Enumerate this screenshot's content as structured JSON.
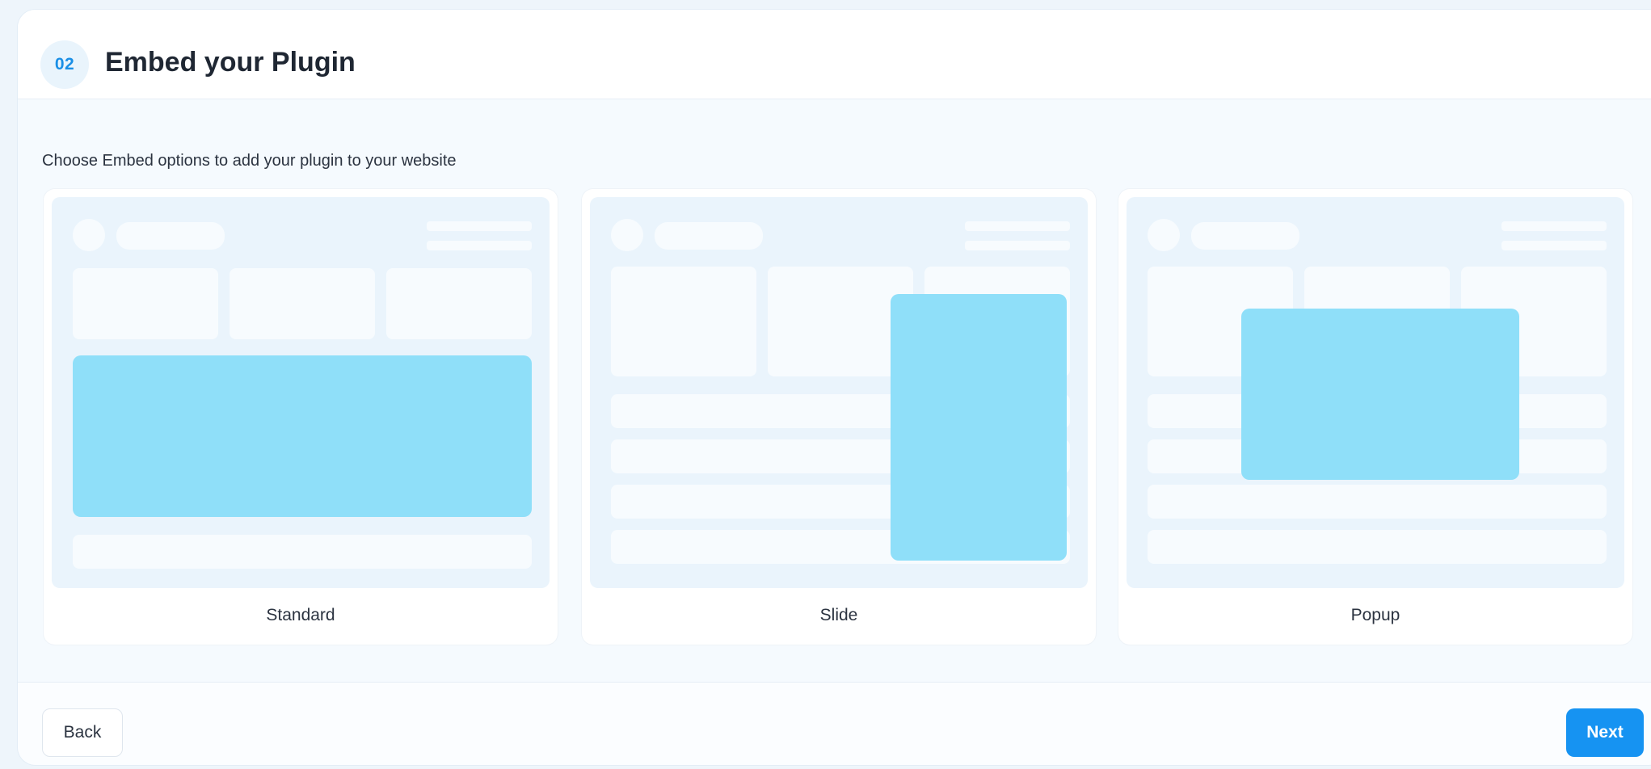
{
  "header": {
    "step_number": "02",
    "title": "Embed your Plugin"
  },
  "main": {
    "subtitle": "Choose Embed options to add your plugin to your website",
    "options": [
      {
        "label": "Standard"
      },
      {
        "label": "Slide"
      },
      {
        "label": "Popup"
      }
    ]
  },
  "footer": {
    "back_label": "Back",
    "next_label": "Next"
  },
  "colors": {
    "accent": "#1693f2",
    "embed_highlight": "#8fdff9",
    "preview_bg": "#eaf4fc"
  }
}
